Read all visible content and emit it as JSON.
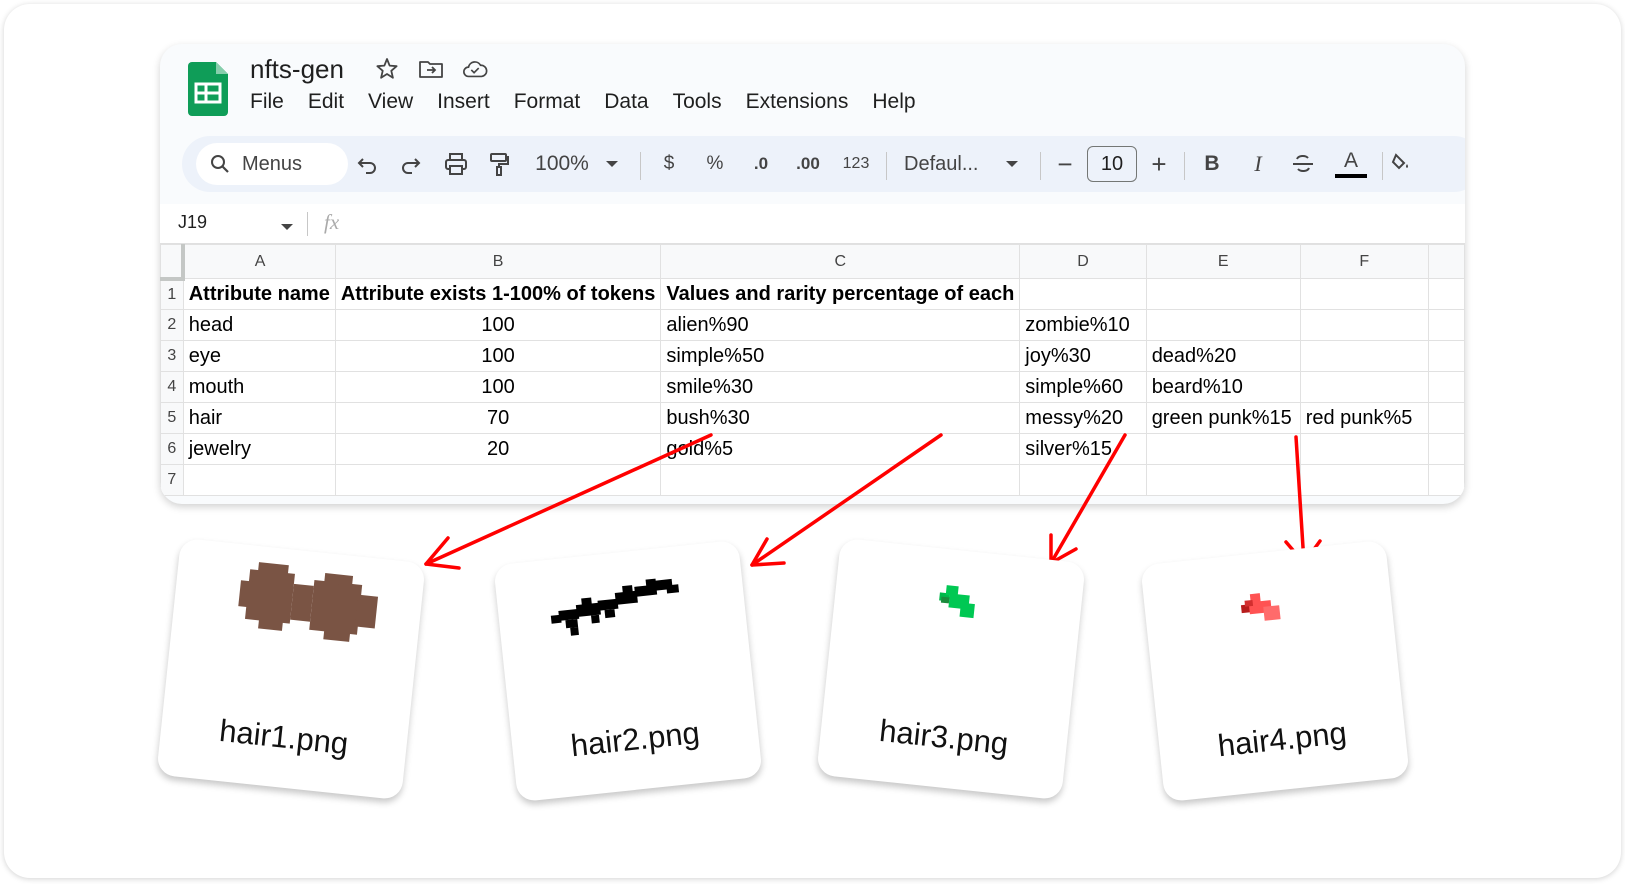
{
  "app": {
    "doc_title": "nfts-gen",
    "menu": [
      "File",
      "Edit",
      "View",
      "Insert",
      "Format",
      "Data",
      "Tools",
      "Extensions",
      "Help"
    ],
    "icons": {
      "logo": "sheets-logo-icon",
      "star": "star-icon",
      "move": "move-folder-icon",
      "cloud": "cloud-status-icon"
    },
    "accent_color": "#0f9d58"
  },
  "toolbar": {
    "search_placeholder": "Menus",
    "zoom": "100%",
    "currency": "$",
    "percent": "%",
    "decrease_decimal": ".0",
    "increase_decimal": ".00",
    "number_format": "123",
    "font": "Defaul...",
    "minus": "−",
    "font_size": "10",
    "plus": "+",
    "bold": "B",
    "italic": "I",
    "text_color": "A"
  },
  "formula_bar": {
    "cell_ref": "J19",
    "fx": "fx"
  },
  "sheet": {
    "columns": [
      "A",
      "B",
      "C",
      "D",
      "E",
      "F"
    ],
    "rows": [
      {
        "n": "1",
        "cells": [
          "Attribute name",
          "Attribute exists 1-100% of tokens",
          "Values and rarity percentage of each",
          "",
          "",
          ""
        ]
      },
      {
        "n": "2",
        "cells": [
          "head",
          "100",
          "alien%90",
          "zombie%10",
          "",
          ""
        ]
      },
      {
        "n": "3",
        "cells": [
          "eye",
          "100",
          "simple%50",
          "joy%30",
          "dead%20",
          ""
        ]
      },
      {
        "n": "4",
        "cells": [
          "mouth",
          "100",
          "smile%30",
          "simple%60",
          "beard%10",
          ""
        ]
      },
      {
        "n": "5",
        "cells": [
          "hair",
          "70",
          "bush%30",
          "messy%20",
          "green punk%15",
          "red punk%5"
        ]
      },
      {
        "n": "6",
        "cells": [
          "jewelry",
          "20",
          "gold%5",
          "silver%15",
          "",
          ""
        ]
      },
      {
        "n": "7",
        "cells": [
          "",
          "",
          "",
          "",
          "",
          ""
        ]
      }
    ]
  },
  "cards": [
    {
      "label": "hair1.png",
      "color": "#7a5444"
    },
    {
      "label": "hair2.png",
      "color": "#000000"
    },
    {
      "label": "hair3.png",
      "color": "#00c853"
    },
    {
      "label": "hair4.png",
      "color": "#ff5252"
    }
  ],
  "arrow_color": "#ff0000"
}
